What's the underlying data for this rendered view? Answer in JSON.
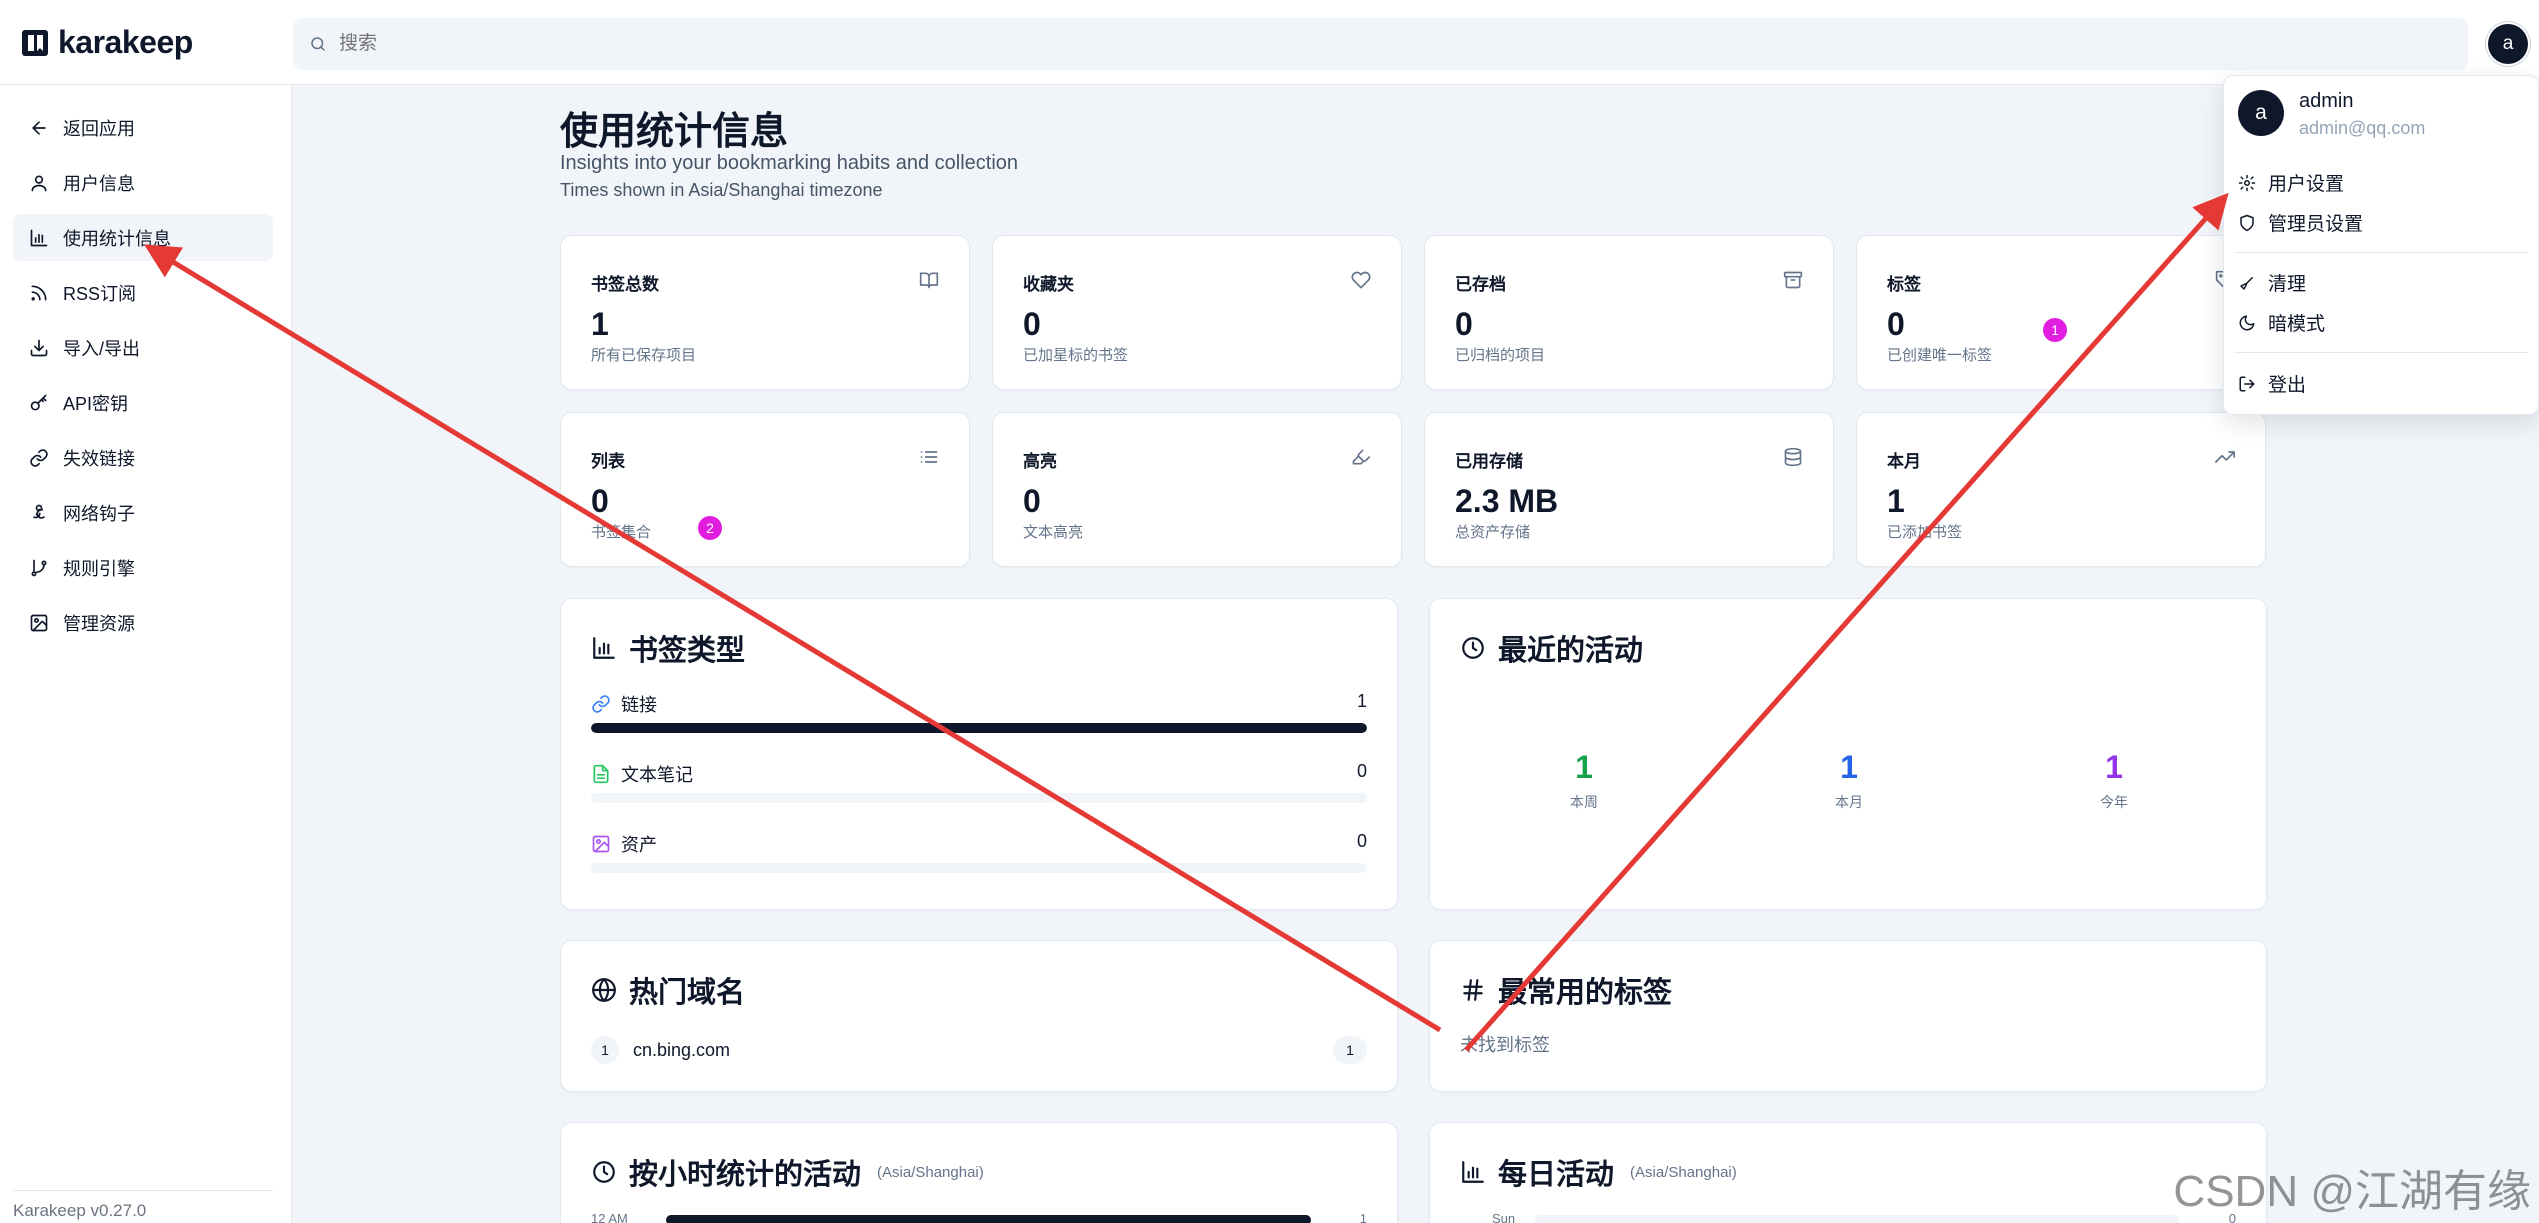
{
  "brand": {
    "name": "karakeep"
  },
  "search": {
    "placeholder": "搜索"
  },
  "user": {
    "initial": "a",
    "name": "admin",
    "email": "admin@qq.com"
  },
  "sidebar": {
    "items": [
      {
        "label": "返回应用",
        "icon": "arrow-left-icon"
      },
      {
        "label": "用户信息",
        "icon": "user-icon"
      },
      {
        "label": "使用统计信息",
        "icon": "bar-chart-icon",
        "active": true
      },
      {
        "label": "RSS订阅",
        "icon": "rss-icon"
      },
      {
        "label": "导入/导出",
        "icon": "download-icon"
      },
      {
        "label": "API密钥",
        "icon": "key-icon"
      },
      {
        "label": "失效链接",
        "icon": "link-icon"
      },
      {
        "label": "网络钩子",
        "icon": "webhook-icon"
      },
      {
        "label": "规则引擎",
        "icon": "git-branch-icon"
      },
      {
        "label": "管理资源",
        "icon": "image-icon"
      }
    ],
    "version": "Karakeep v0.27.0"
  },
  "page": {
    "title": "使用统计信息",
    "subtitle": "Insights into your bookmarking habits and collection",
    "timezone_note": "Times shown in Asia/Shanghai timezone"
  },
  "stats": [
    {
      "label": "书签总数",
      "value": "1",
      "desc": "所有已保存项目",
      "icon": "book-open-icon"
    },
    {
      "label": "收藏夹",
      "value": "0",
      "desc": "已加星标的书签",
      "icon": "heart-icon"
    },
    {
      "label": "已存档",
      "value": "0",
      "desc": "已归档的项目",
      "icon": "archive-icon"
    },
    {
      "label": "标签",
      "value": "0",
      "desc": "已创建唯一标签",
      "icon": "tag-icon"
    },
    {
      "label": "列表",
      "value": "0",
      "desc": "书签集合",
      "icon": "list-icon"
    },
    {
      "label": "高亮",
      "value": "0",
      "desc": "文本高亮",
      "icon": "highlighter-icon"
    },
    {
      "label": "已用存储",
      "value": "2.3 MB",
      "desc": "总资产存储",
      "icon": "database-icon"
    },
    {
      "label": "本月",
      "value": "1",
      "desc": "已添加书签",
      "icon": "trending-up-icon"
    }
  ],
  "bookmark_types": {
    "title": "书签类型",
    "items": [
      {
        "label": "链接",
        "count": "1",
        "fraction": 1.0,
        "icon": "link-icon",
        "color": "#3b82f6"
      },
      {
        "label": "文本笔记",
        "count": "0",
        "fraction": 0.0,
        "icon": "file-text-icon",
        "color": "#22c55e"
      },
      {
        "label": "资产",
        "count": "0",
        "fraction": 0.0,
        "icon": "image-icon",
        "color": "#a855f7"
      }
    ]
  },
  "recent_activity": {
    "title": "最近的活动",
    "items": [
      {
        "value": "1",
        "label": "本周",
        "color": "#16a34a"
      },
      {
        "value": "1",
        "label": "本月",
        "color": "#2563eb"
      },
      {
        "value": "1",
        "label": "今年",
        "color": "#9333ea"
      }
    ]
  },
  "top_domains": {
    "title": "热门域名",
    "items": [
      {
        "rank": "1",
        "domain": "cn.bing.com",
        "count": "1"
      }
    ]
  },
  "top_tags": {
    "title": "最常用的标签",
    "empty": "未找到标签"
  },
  "hourly": {
    "title": "按小时统计的活动",
    "tz": "(Asia/Shanghai)",
    "first_label": "12 AM",
    "first_value": "1"
  },
  "daily": {
    "title": "每日活动",
    "tz": "(Asia/Shanghai)",
    "first_label": "Sun",
    "first_value": "0"
  },
  "dropdown": {
    "items": [
      {
        "label": "用户设置",
        "icon": "settings-icon"
      },
      {
        "label": "管理员设置",
        "icon": "shield-icon"
      },
      {
        "label": "清理",
        "icon": "broom-icon"
      },
      {
        "label": "暗模式",
        "icon": "moon-icon"
      },
      {
        "label": "登出",
        "icon": "log-out-icon"
      }
    ]
  },
  "annotations": {
    "badge1": "1",
    "badge2": "2",
    "arrow_color": "#e53935"
  },
  "watermark": "CSDN @江湖有缘"
}
